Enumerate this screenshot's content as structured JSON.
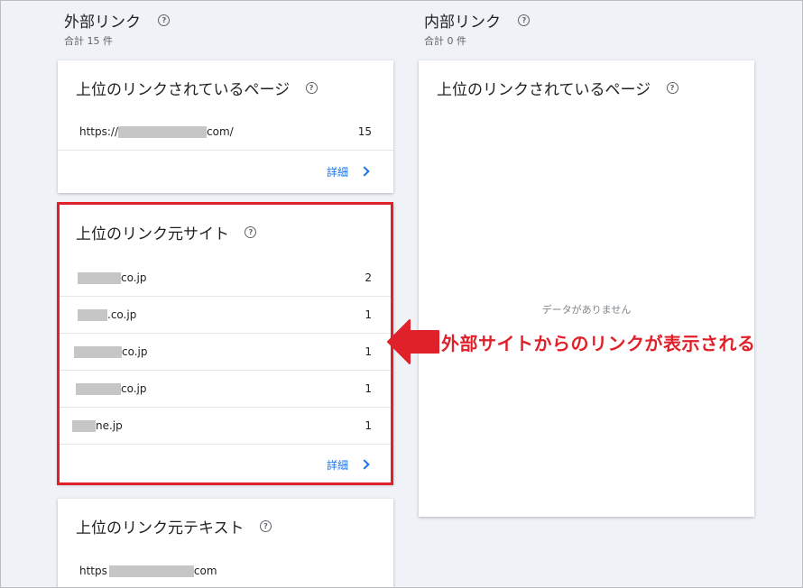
{
  "external": {
    "title": "外部リンク",
    "total": "合計 15 件",
    "top_pages": {
      "title": "上位のリンクされているページ",
      "rows": [
        {
          "prefix": "https://",
          "suffix": "com/",
          "count": "15"
        }
      ],
      "details": "詳細"
    },
    "top_sites": {
      "title": "上位のリンク元サイト",
      "rows": [
        {
          "suffix": "co.jp",
          "count": "2"
        },
        {
          "suffix": ".co.jp",
          "count": "1"
        },
        {
          "suffix": "co.jp",
          "count": "1"
        },
        {
          "suffix": "co.jp",
          "count": "1"
        },
        {
          "suffix": "ne.jp",
          "count": "1"
        }
      ],
      "details": "詳細"
    },
    "top_text": {
      "title": "上位のリンク元テキスト",
      "rows": [
        {
          "prefix": "https",
          "suffix": "com"
        }
      ]
    }
  },
  "internal": {
    "title": "内部リンク",
    "total": "合計 0 件",
    "top_pages": {
      "title": "上位のリンクされているページ",
      "empty": "データがありません"
    }
  },
  "annotation": {
    "text": "外部サイトからのリンクが表示される",
    "color": "#e0212a"
  },
  "icons": {
    "help": "help-circle-icon",
    "chevron": "chevron-right-icon",
    "arrow": "left-arrow-icon"
  }
}
